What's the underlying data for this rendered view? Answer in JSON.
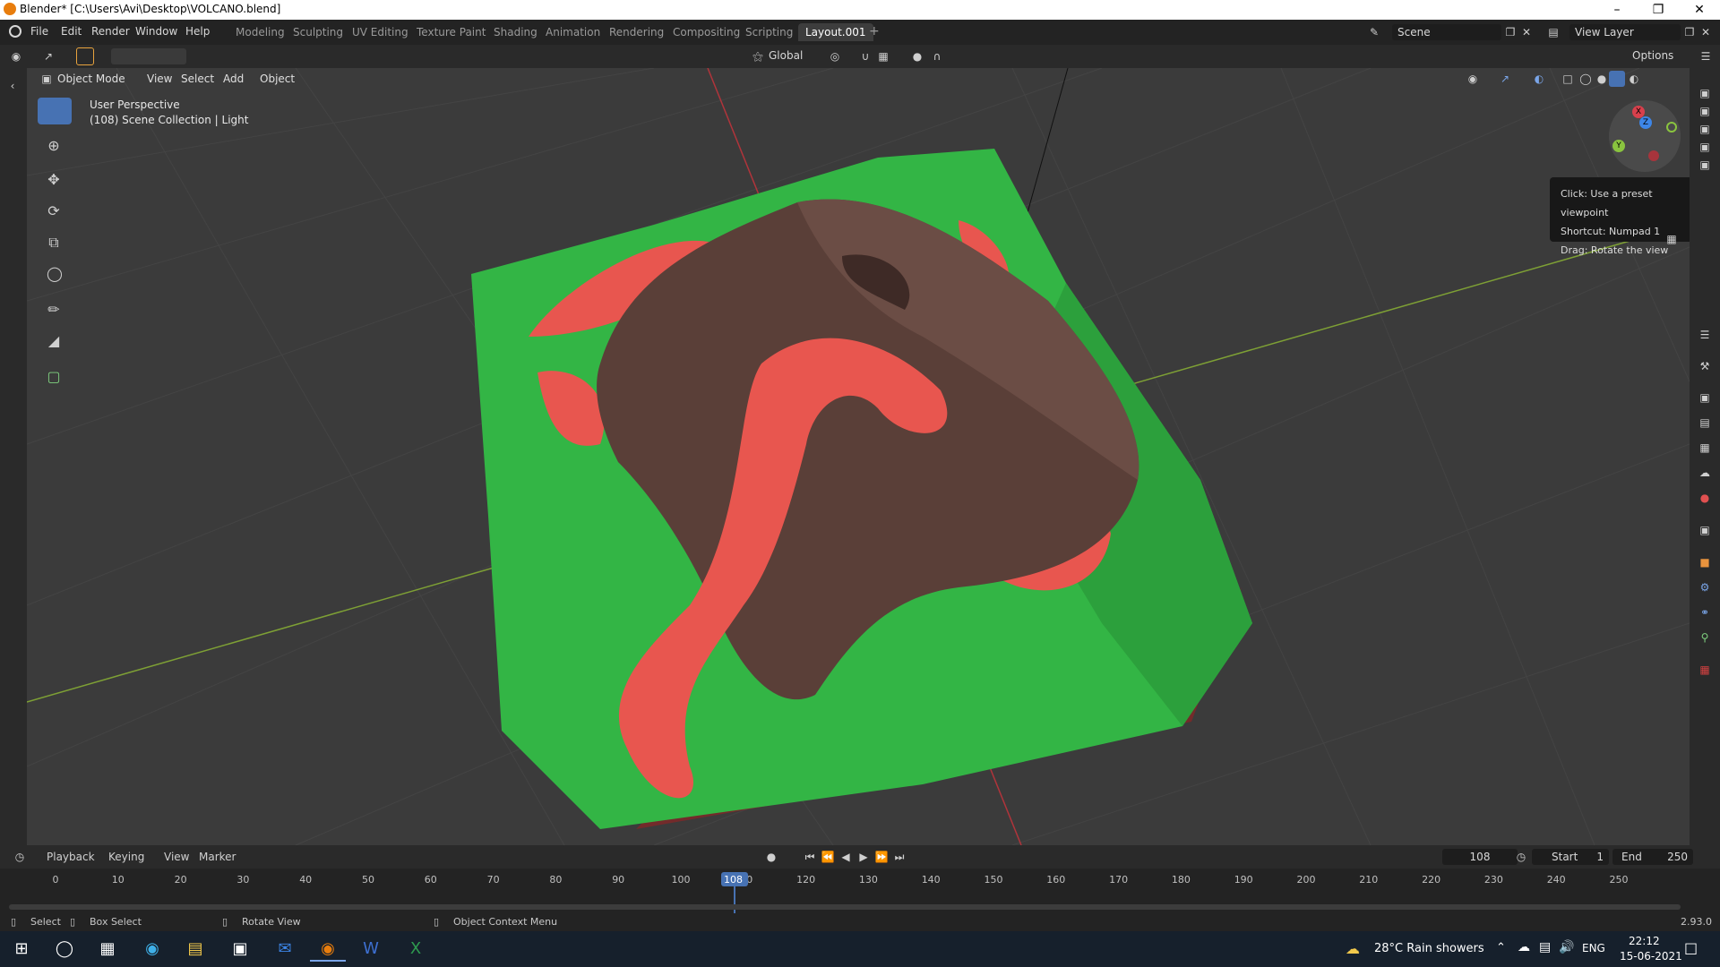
{
  "window": {
    "title": "Blender* [C:\\Users\\Avi\\Desktop\\VOLCANO.blend]",
    "minimize": "–",
    "maximize": "❐",
    "close": "✕"
  },
  "menu": {
    "file": "File",
    "edit": "Edit",
    "render": "Render",
    "window": "Window",
    "help": "Help"
  },
  "workspaces": [
    "Modeling",
    "Sculpting",
    "UV Editing",
    "Texture Paint",
    "Shading",
    "Animation",
    "Rendering",
    "Compositing",
    "Scripting",
    "Layout.001"
  ],
  "add_workspace": "+",
  "scene": {
    "name": "Scene",
    "view_layer": "View Layer"
  },
  "tool_header": {
    "orientation": "Global",
    "options": "Options"
  },
  "view_header": {
    "mode": "Object Mode",
    "view": "View",
    "select": "Select",
    "add": "Add",
    "object": "Object"
  },
  "viewport": {
    "perspective": "User Perspective",
    "collection": "(108) Scene Collection | Light"
  },
  "tooltip": {
    "line1": "Click: Use a preset viewpoint",
    "line2": "Shortcut: Numpad 1",
    "line3": "Drag: Rotate the view"
  },
  "gizmo": {
    "x": "X",
    "y": "Y",
    "z": "Z"
  },
  "timeline": {
    "playback": "Playback",
    "keying": "Keying",
    "view": "View",
    "marker": "Marker",
    "current_frame": "108",
    "start_label": "Start",
    "start": "1",
    "end_label": "End",
    "end": "250",
    "ticks": [
      "0",
      "10",
      "20",
      "30",
      "40",
      "50",
      "60",
      "70",
      "80",
      "90",
      "100",
      "110",
      "120",
      "130",
      "140",
      "150",
      "160",
      "170",
      "180",
      "190",
      "200",
      "210",
      "220",
      "230",
      "240",
      "250"
    ]
  },
  "statusbar": {
    "select": "Select",
    "box_select": "Box Select",
    "rotate_view": "Rotate View",
    "context_menu": "Object Context Menu",
    "version": "2.93.0"
  },
  "taskbar": {
    "weather": "28°C  Rain showers",
    "lang": "ENG",
    "time": "22:12",
    "date": "15-06-2021"
  },
  "colors": {
    "terrain_green": "#2fb33f",
    "lava_red": "#e8564f",
    "rock_brown": "#5a3f38",
    "active_blue": "#4772b3"
  }
}
